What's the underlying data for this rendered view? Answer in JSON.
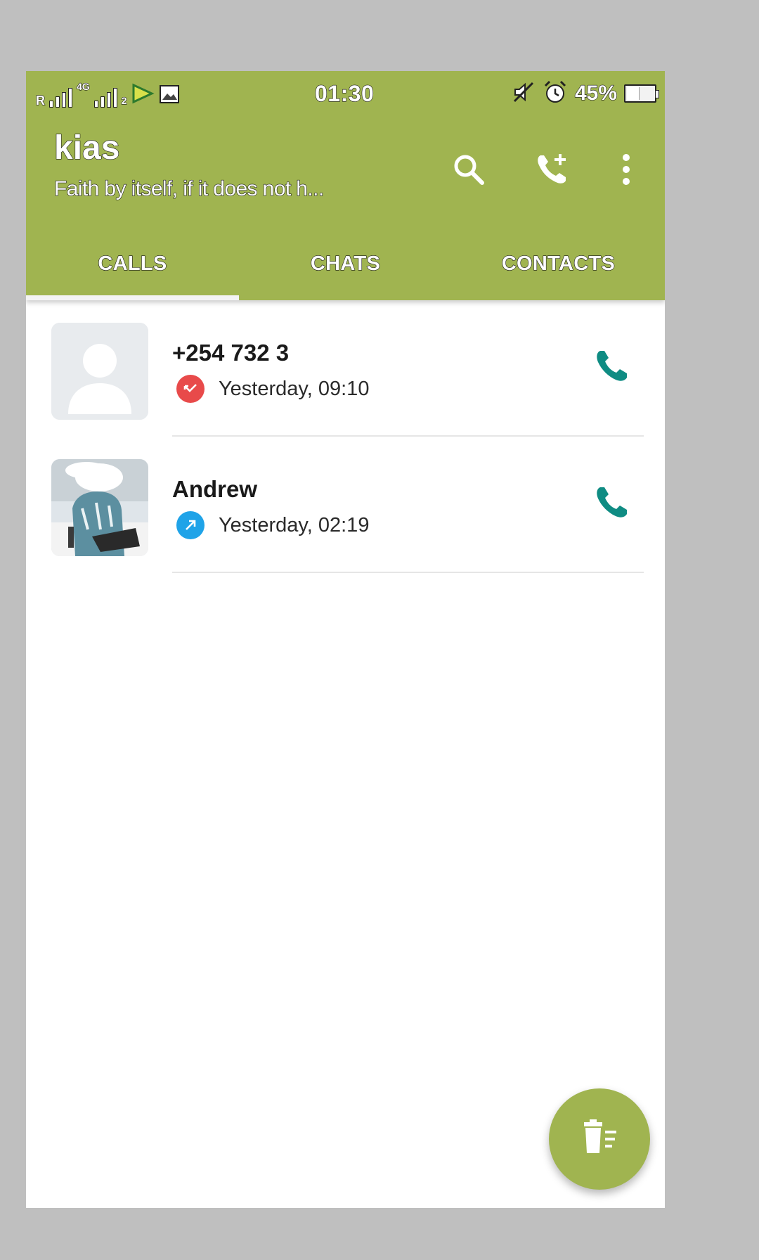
{
  "status_bar": {
    "carrier_label": "R",
    "network_label": "4G",
    "sim_label": "2",
    "time": "01:30",
    "battery": "45%",
    "battery_level": 0.45
  },
  "header": {
    "title": "kias",
    "subtitle": "Faith by itself, if it does not h...",
    "actions": [
      {
        "icon": "search-icon"
      },
      {
        "icon": "add-call-icon"
      },
      {
        "icon": "more-vert-icon"
      }
    ]
  },
  "tabs": [
    {
      "label": "CALLS",
      "selected": true
    },
    {
      "label": "CHATS",
      "selected": false
    },
    {
      "label": "CONTACTS",
      "selected": false
    }
  ],
  "calls": [
    {
      "name": "+254 732 3",
      "time": "Yesterday, 09:10",
      "direction": "missed",
      "direction_color": "#e84a4a",
      "avatar": "placeholder-avatar-icon"
    },
    {
      "name": "Andrew",
      "time": "Yesterday, 02:19",
      "direction": "outgoing",
      "direction_color": "#1fa3e8",
      "avatar": "contact-photo"
    }
  ],
  "fab": {
    "icon": "delete-list-icon"
  },
  "colors": {
    "primary": "#a0b450",
    "call_icon": "#0f8c83",
    "background": "#ffffff",
    "frame": "#bfbfbf"
  }
}
